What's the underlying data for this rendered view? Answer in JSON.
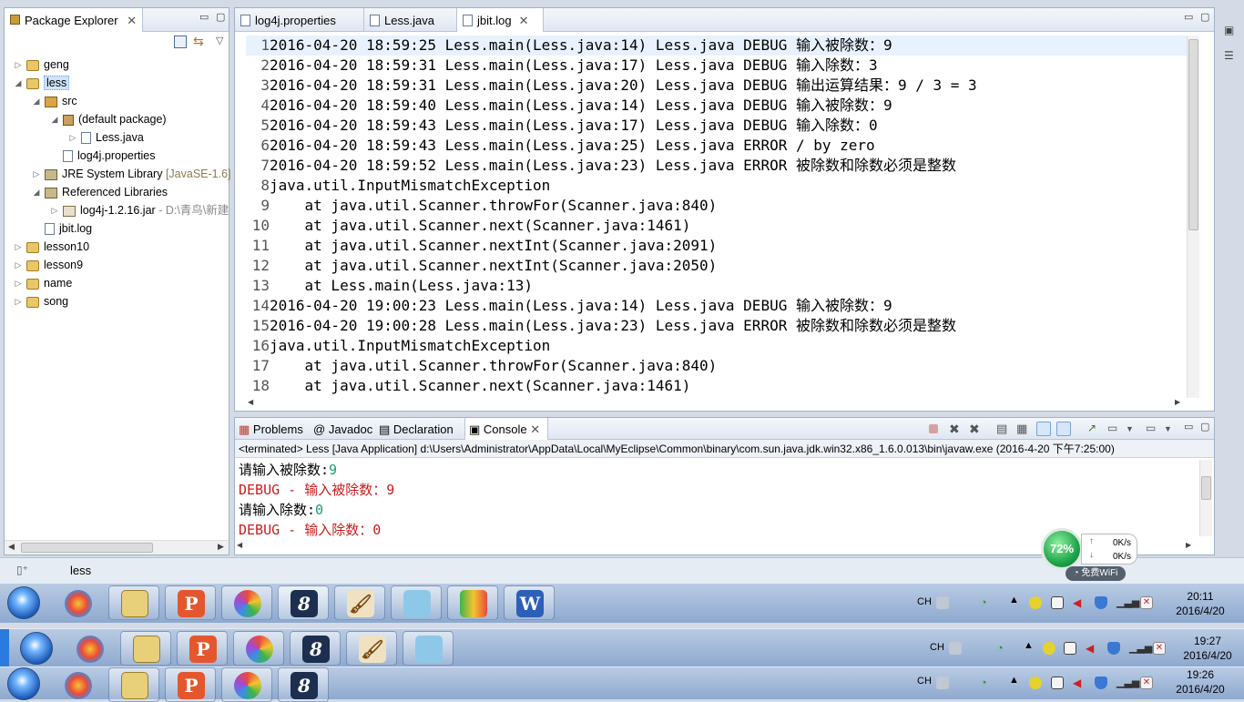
{
  "package_explorer": {
    "title": "Package Explorer",
    "tree": [
      {
        "label": "geng",
        "extra": ""
      },
      {
        "label": "less",
        "extra": ""
      },
      {
        "label": "src",
        "extra": ""
      },
      {
        "label": "(default package)",
        "extra": ""
      },
      {
        "label": "Less.java",
        "extra": ""
      },
      {
        "label": "log4j.properties",
        "extra": ""
      },
      {
        "label": "JRE System Library",
        "extra": "[JavaSE-1.6]"
      },
      {
        "label": "Referenced Libraries",
        "extra": ""
      },
      {
        "label": "log4j-1.2.16.jar",
        "extra": "- D:\\青鸟\\新建"
      },
      {
        "label": "jbit.log",
        "extra": ""
      },
      {
        "label": "lesson10",
        "extra": ""
      },
      {
        "label": "lesson9",
        "extra": ""
      },
      {
        "label": "name",
        "extra": ""
      },
      {
        "label": "song",
        "extra": ""
      }
    ]
  },
  "editor": {
    "tabs": [
      {
        "label": "log4j.properties"
      },
      {
        "label": "Less.java"
      },
      {
        "label": "jbit.log"
      }
    ],
    "lines": [
      {
        "n": "1",
        "text": "2016-04-20 18:59:25 Less.main(Less.java:14) Less.java DEBUG 输入被除数：9"
      },
      {
        "n": "2",
        "text": "2016-04-20 18:59:31 Less.main(Less.java:17) Less.java DEBUG 输入除数：3"
      },
      {
        "n": "3",
        "text": "2016-04-20 18:59:31 Less.main(Less.java:20) Less.java DEBUG 输出运算结果：9 / 3 = 3"
      },
      {
        "n": "4",
        "text": "2016-04-20 18:59:40 Less.main(Less.java:14) Less.java DEBUG 输入被除数：9"
      },
      {
        "n": "5",
        "text": "2016-04-20 18:59:43 Less.main(Less.java:17) Less.java DEBUG 输入除数：0"
      },
      {
        "n": "6",
        "text": "2016-04-20 18:59:43 Less.main(Less.java:25) Less.java ERROR / by zero"
      },
      {
        "n": "7",
        "text": "2016-04-20 18:59:52 Less.main(Less.java:23) Less.java ERROR 被除数和除数必须是整数"
      },
      {
        "n": "8",
        "text": "java.util.InputMismatchException"
      },
      {
        "n": "9",
        "text": "    at java.util.Scanner.throwFor(Scanner.java:840)"
      },
      {
        "n": "10",
        "text": "    at java.util.Scanner.next(Scanner.java:1461)"
      },
      {
        "n": "11",
        "text": "    at java.util.Scanner.nextInt(Scanner.java:2091)"
      },
      {
        "n": "12",
        "text": "    at java.util.Scanner.nextInt(Scanner.java:2050)"
      },
      {
        "n": "13",
        "text": "    at Less.main(Less.java:13)"
      },
      {
        "n": "14",
        "text": "2016-04-20 19:00:23 Less.main(Less.java:14) Less.java DEBUG 输入被除数：9"
      },
      {
        "n": "15",
        "text": "2016-04-20 19:00:28 Less.main(Less.java:23) Less.java ERROR 被除数和除数必须是整数"
      },
      {
        "n": "16",
        "text": "java.util.InputMismatchException"
      },
      {
        "n": "17",
        "text": "    at java.util.Scanner.throwFor(Scanner.java:840)"
      },
      {
        "n": "18",
        "text": "    at java.util.Scanner.next(Scanner.java:1461)"
      }
    ]
  },
  "console": {
    "tabs": [
      {
        "label": "Problems"
      },
      {
        "label": "Javadoc"
      },
      {
        "label": "Declaration"
      },
      {
        "label": "Console"
      }
    ],
    "status": "<terminated> Less [Java Application] d:\\Users\\Administrator\\AppData\\Local\\MyEclipse\\Common\\binary\\com.sun.java.jdk.win32.x86_1.6.0.013\\bin\\javaw.exe (2016-4-20 下午7:25:00)",
    "lines": [
      {
        "prompt": "请输入被除数:",
        "input": "9"
      },
      {
        "debug": "DEBUG - 输入被除数：9"
      },
      {
        "prompt": "请输入除数:",
        "input": "0"
      },
      {
        "debug": "DEBUG - 输入除数：0"
      }
    ]
  },
  "status_bar": {
    "selection": "less"
  },
  "wifi": {
    "percent": "72%",
    "up": "0K/s",
    "down": "0K/s",
    "free_label": "免费WiFi"
  },
  "taskbars": [
    {
      "lang": "CH",
      "time": "20:11",
      "date": "2016/4/20"
    },
    {
      "lang": "CH",
      "time": "19:27",
      "date": "2016/4/20"
    },
    {
      "lang": "CH",
      "time": "19:26",
      "date": "2016/4/20"
    }
  ],
  "colors": {
    "console_debug": "#c81d1d",
    "console_input": "#169e78",
    "taskbar": "#9fb8da"
  }
}
